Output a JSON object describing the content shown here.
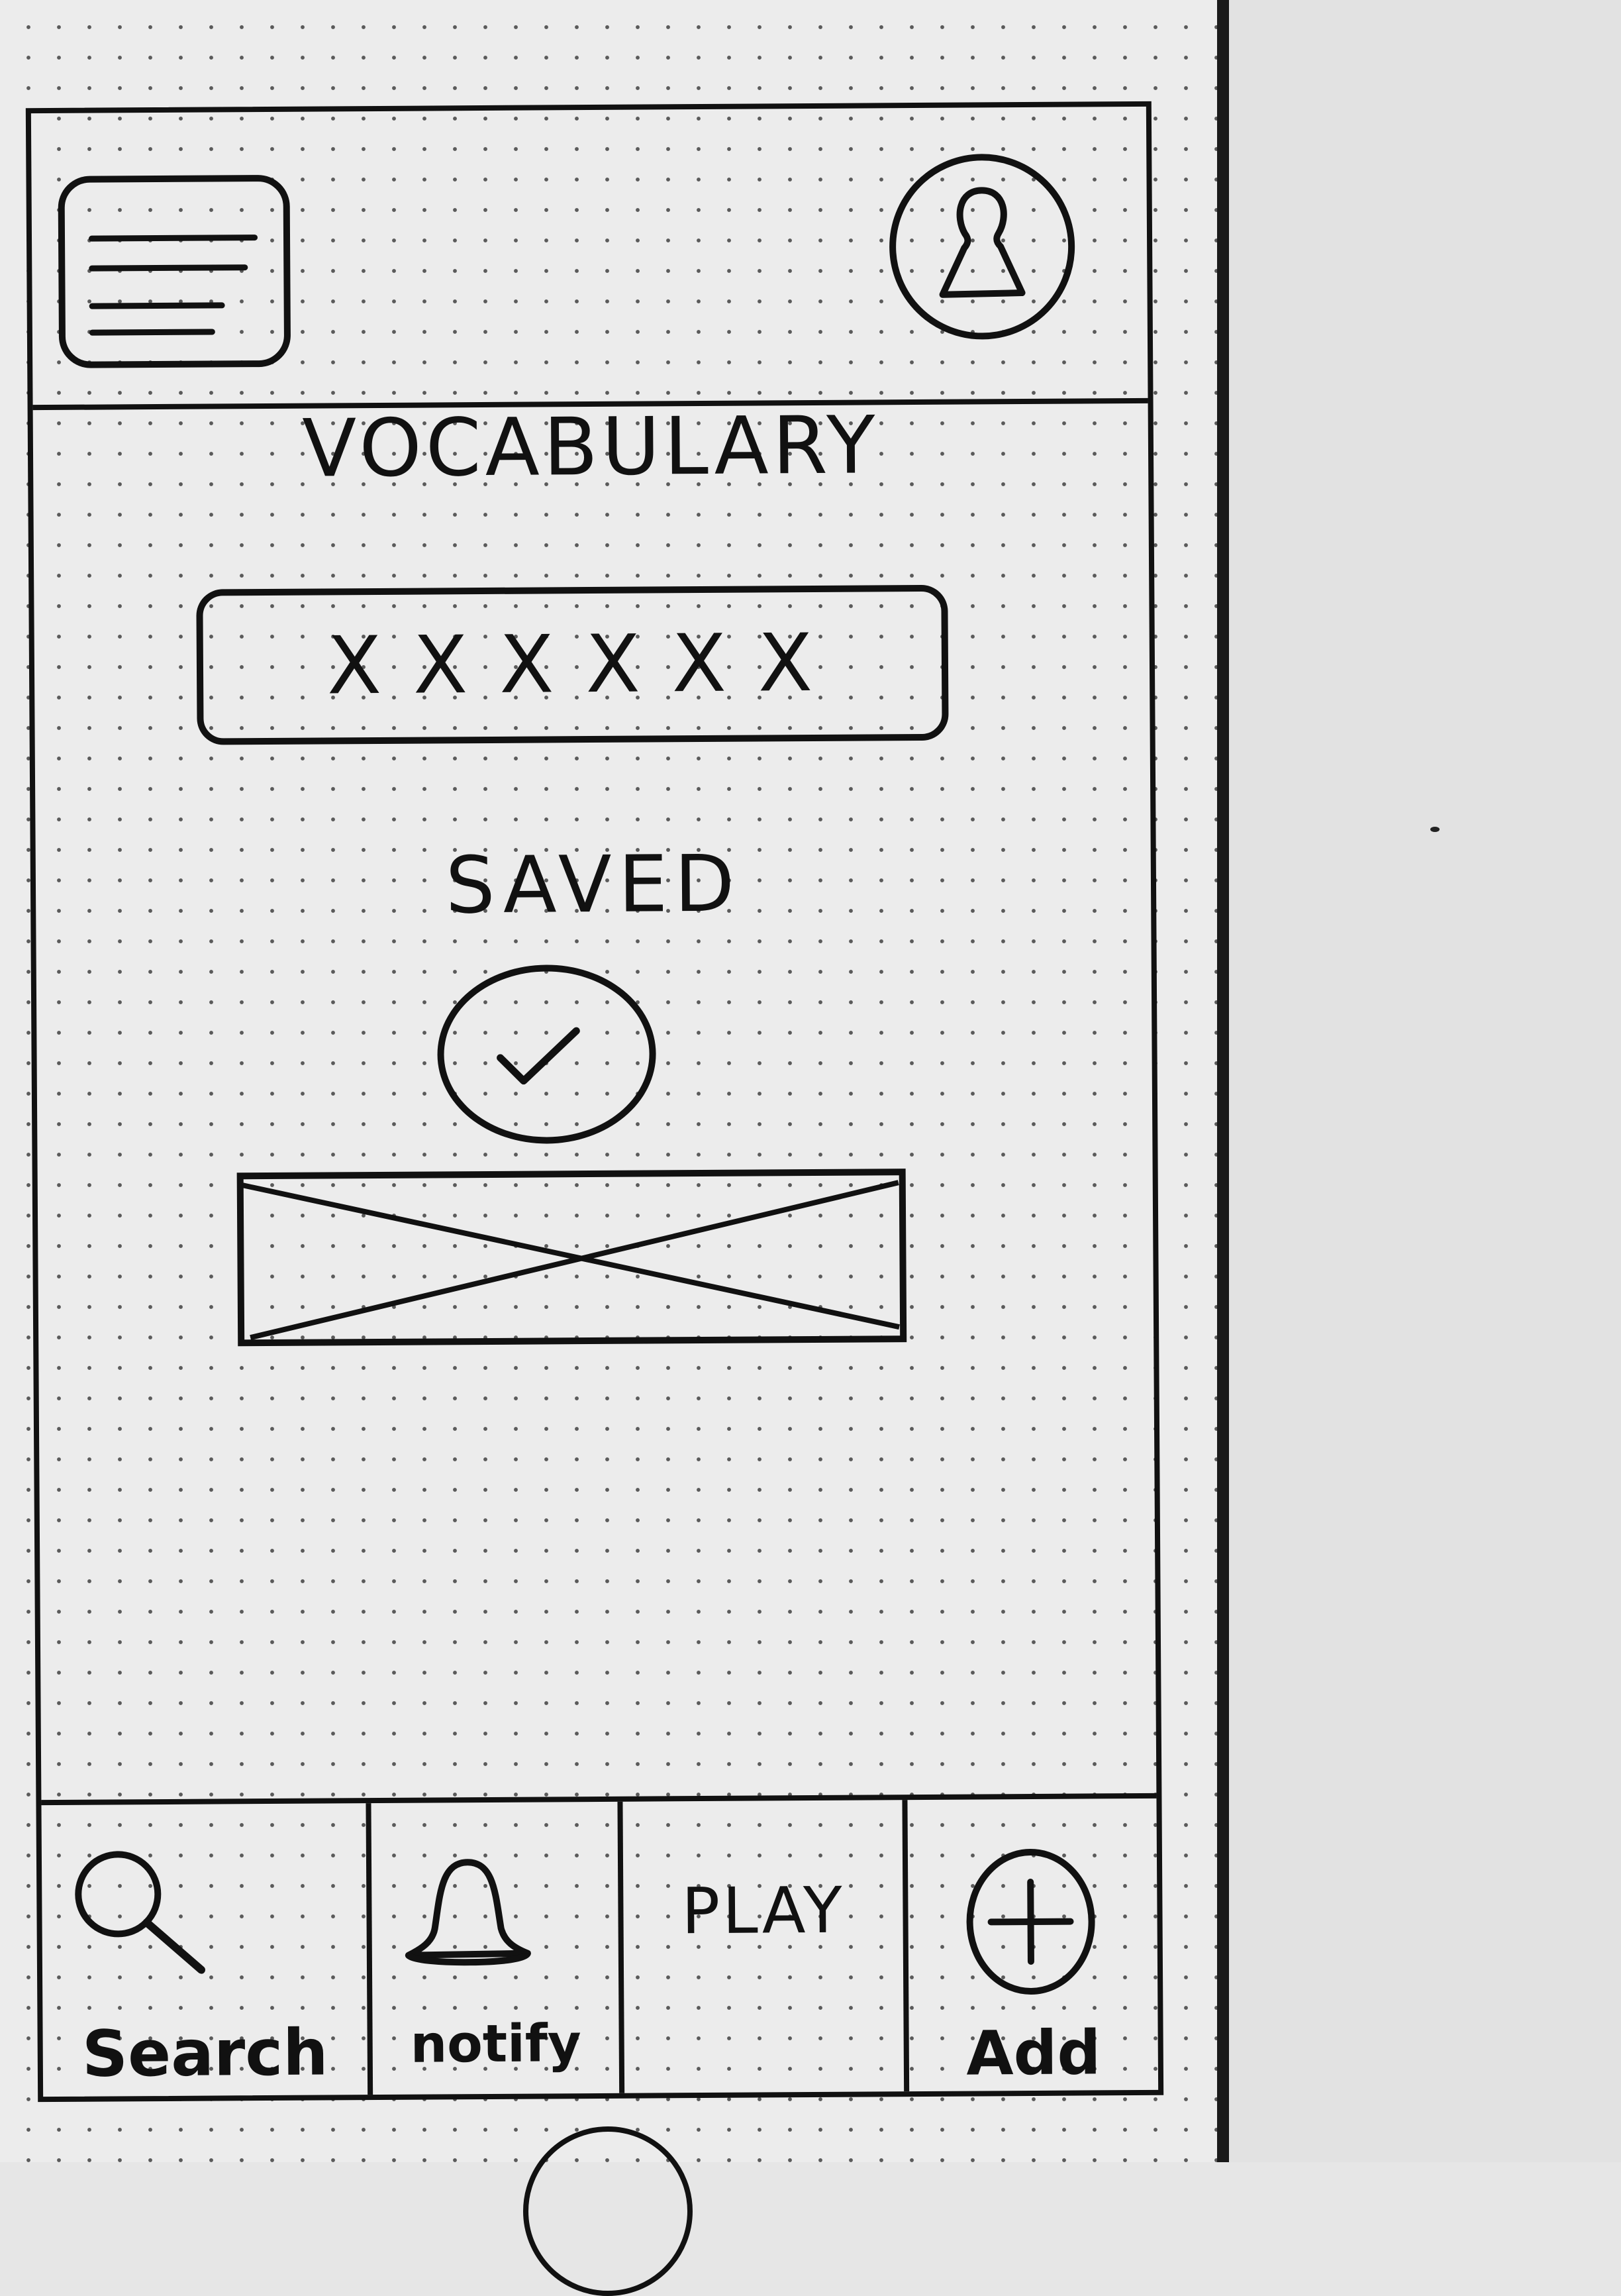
{
  "screen": {
    "title": "VOCABULARY",
    "password_mask": "XXXXXX",
    "status_text": "SAVED",
    "status_icon": "check-circle-icon",
    "image_placeholder": "image-placeholder"
  },
  "header": {
    "menu_icon": "hamburger-menu-icon",
    "profile_icon": "user-avatar-icon"
  },
  "tabs": [
    {
      "label": "Search",
      "icon": "search-icon"
    },
    {
      "label": "notify",
      "icon": "bell-icon"
    },
    {
      "label": "PLAY",
      "icon": ""
    },
    {
      "label": "Add",
      "icon": "plus-circle-icon"
    }
  ],
  "colors": {
    "ink": "#111111",
    "paper": "#ececec"
  }
}
